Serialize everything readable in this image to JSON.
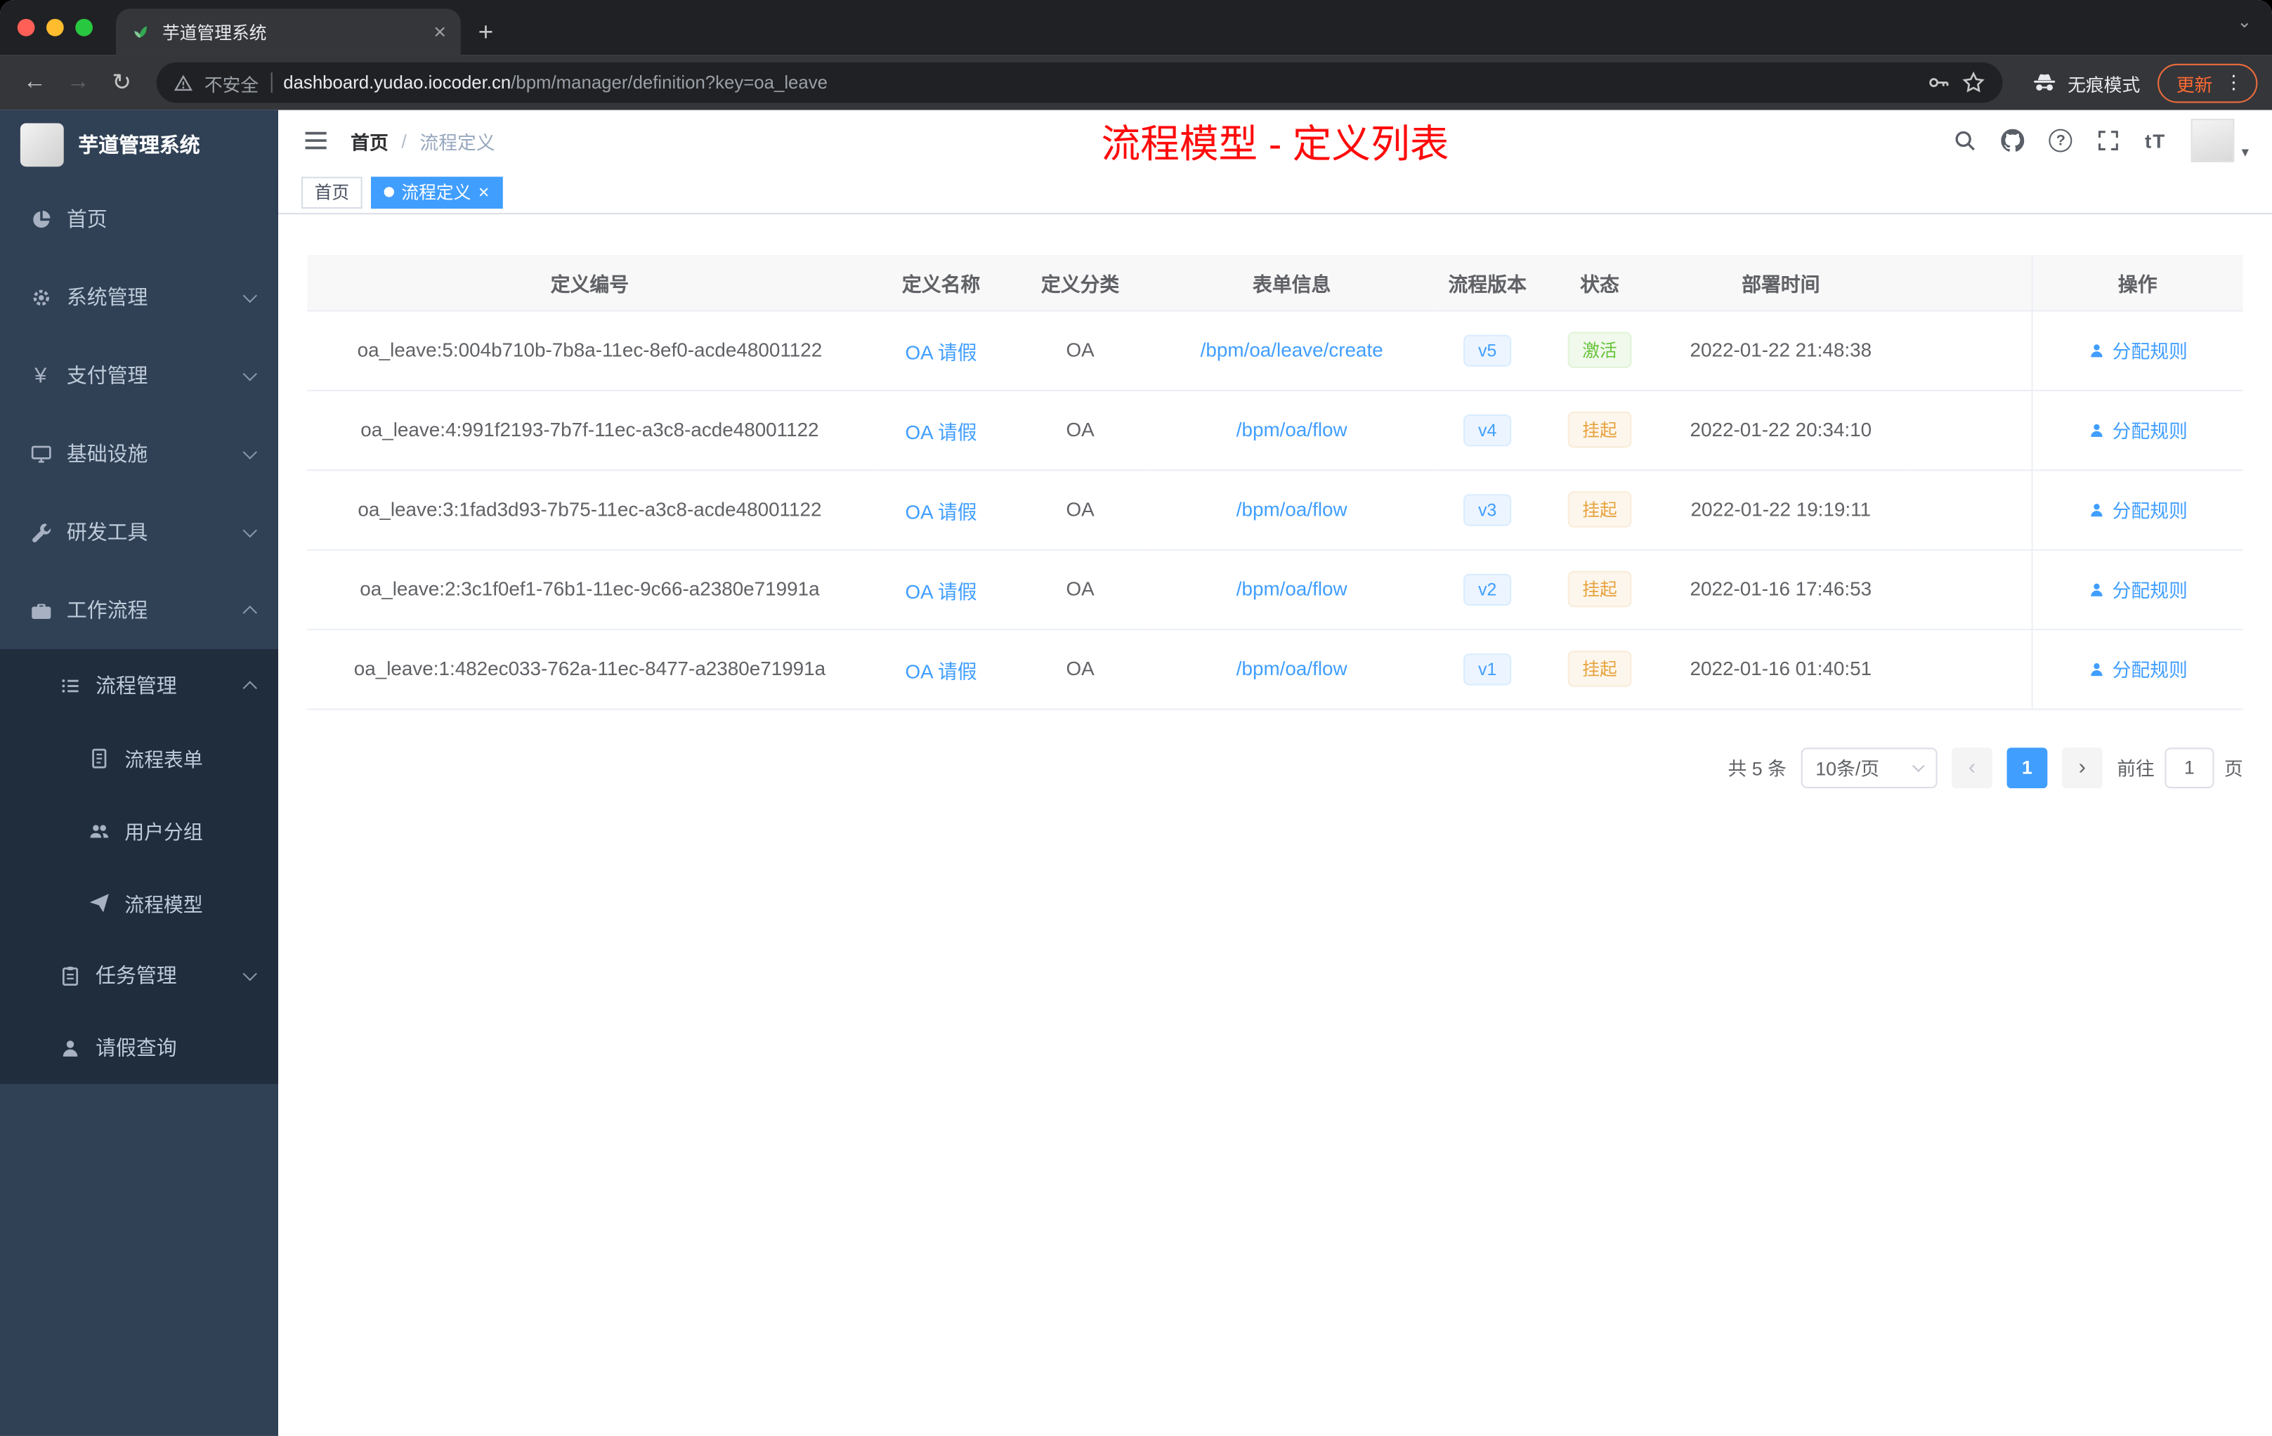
{
  "colors": {
    "accent": "#409eff",
    "success": "#67c23a",
    "warning": "#e6a23c",
    "annotation_red": "#ff0b0b",
    "sidebar_bg": "#304156",
    "submenu_bg": "#1f2d3d"
  },
  "browser": {
    "tab_title": "芋道管理系统",
    "security_label": "不安全",
    "url_host": "dashboard.yudao.iocoder.cn",
    "url_path": "/bpm/manager/definition?key=oa_leave",
    "incognito_label": "无痕模式",
    "update_label": "更新"
  },
  "sidebar": {
    "logo_text": "芋道管理系统",
    "items": [
      {
        "label": "首页"
      },
      {
        "label": "系统管理"
      },
      {
        "label": "支付管理"
      },
      {
        "label": "基础设施"
      },
      {
        "label": "研发工具"
      },
      {
        "label": "工作流程"
      }
    ],
    "workflow_submenu": [
      {
        "label": "流程管理",
        "children": [
          "流程表单",
          "用户分组",
          "流程模型"
        ]
      },
      {
        "label": "任务管理"
      },
      {
        "label": "请假查询"
      }
    ]
  },
  "header": {
    "breadcrumb_home": "首页",
    "breadcrumb_separator": "/",
    "breadcrumb_current": "流程定义",
    "annotation": "流程模型 - 定义列表",
    "help_icon": "?",
    "font_size_icon": "tT"
  },
  "tags": {
    "home": "首页",
    "active": "流程定义"
  },
  "table": {
    "columns": [
      "定义编号",
      "定义名称",
      "定义分类",
      "表单信息",
      "流程版本",
      "状态",
      "部署时间",
      "操作"
    ],
    "rows": [
      {
        "id": "oa_leave:5:004b710b-7b8a-11ec-8ef0-acde48001122",
        "name": "OA 请假",
        "category": "OA",
        "form": "/bpm/oa/leave/create",
        "version": "v5",
        "status": "激活",
        "status_type": "success",
        "time": "2022-01-22 21:48:38",
        "action": "分配规则"
      },
      {
        "id": "oa_leave:4:991f2193-7b7f-11ec-a3c8-acde48001122",
        "name": "OA 请假",
        "category": "OA",
        "form": "/bpm/oa/flow",
        "version": "v4",
        "status": "挂起",
        "status_type": "warning",
        "time": "2022-01-22 20:34:10",
        "action": "分配规则"
      },
      {
        "id": "oa_leave:3:1fad3d93-7b75-11ec-a3c8-acde48001122",
        "name": "OA 请假",
        "category": "OA",
        "form": "/bpm/oa/flow",
        "version": "v3",
        "status": "挂起",
        "status_type": "warning",
        "time": "2022-01-22 19:19:11",
        "action": "分配规则"
      },
      {
        "id": "oa_leave:2:3c1f0ef1-76b1-11ec-9c66-a2380e71991a",
        "name": "OA 请假",
        "category": "OA",
        "form": "/bpm/oa/flow",
        "version": "v2",
        "status": "挂起",
        "status_type": "warning",
        "time": "2022-01-16 17:46:53",
        "action": "分配规则"
      },
      {
        "id": "oa_leave:1:482ec033-762a-11ec-8477-a2380e71991a",
        "name": "OA 请假",
        "category": "OA",
        "form": "/bpm/oa/flow",
        "version": "v1",
        "status": "挂起",
        "status_type": "warning",
        "time": "2022-01-16 01:40:51",
        "action": "分配规则"
      }
    ]
  },
  "pagination": {
    "total_label": "共 5 条",
    "page_size": "10条/页",
    "prev_icon": "‹",
    "next_icon": "›",
    "current_page": "1",
    "goto_label": "前往",
    "goto_value": "1",
    "unit_label": "页"
  }
}
